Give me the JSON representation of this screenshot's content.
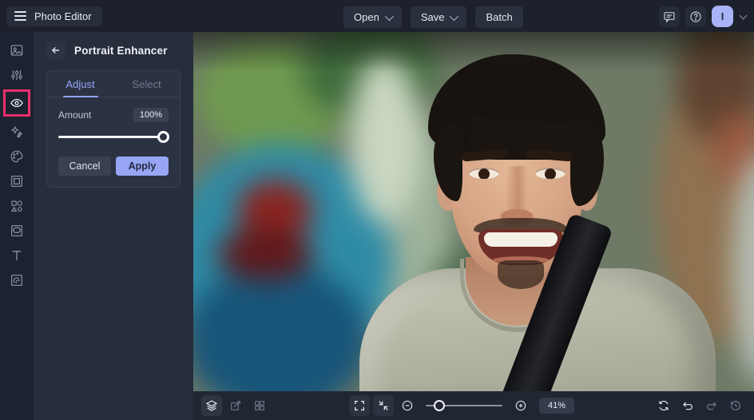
{
  "topbar": {
    "app_title": "Photo Editor",
    "open_label": "Open",
    "save_label": "Save",
    "batch_label": "Batch",
    "avatar_initial": "I"
  },
  "panel": {
    "title": "Portrait Enhancer",
    "tabs": {
      "adjust": "Adjust",
      "select": "Select"
    },
    "amount_label": "Amount",
    "amount_value": "100%",
    "cancel_label": "Cancel",
    "apply_label": "Apply"
  },
  "sidebar": {
    "items": [
      {
        "name": "edit",
        "icon": "image-icon"
      },
      {
        "name": "adjust",
        "icon": "sliders-icon"
      },
      {
        "name": "touch-up",
        "icon": "eye-icon",
        "selected": true,
        "highlight_color": "#ec2e6e"
      },
      {
        "name": "effects",
        "icon": "sparkles-icon"
      },
      {
        "name": "artsy",
        "icon": "palette-icon"
      },
      {
        "name": "frames",
        "icon": "frame-icon"
      },
      {
        "name": "graphics",
        "icon": "shapes-icon"
      },
      {
        "name": "overlays",
        "icon": "overlay-frame-icon"
      },
      {
        "name": "text",
        "icon": "text-icon"
      },
      {
        "name": "textures",
        "icon": "texture-icon"
      }
    ]
  },
  "bottombar": {
    "zoom_value": "41%",
    "left_icons": [
      "layers-icon",
      "transform-icon",
      "pages-grid-icon"
    ],
    "center_icons": [
      "fullscreen-icon",
      "fit-screen-icon",
      "zoom-out-icon",
      "zoom-in-icon"
    ],
    "right_icons": [
      "compare-icon",
      "undo-icon",
      "redo-icon",
      "history-icon"
    ]
  },
  "colors": {
    "accent": "#97a5f4",
    "selection_highlight": "#ec2e6e",
    "topbar_bg": "#1c212c",
    "panel_bg": "#262d3b",
    "apply_button": "#97a5f4",
    "avatar_bg": "#a9b4f8"
  }
}
